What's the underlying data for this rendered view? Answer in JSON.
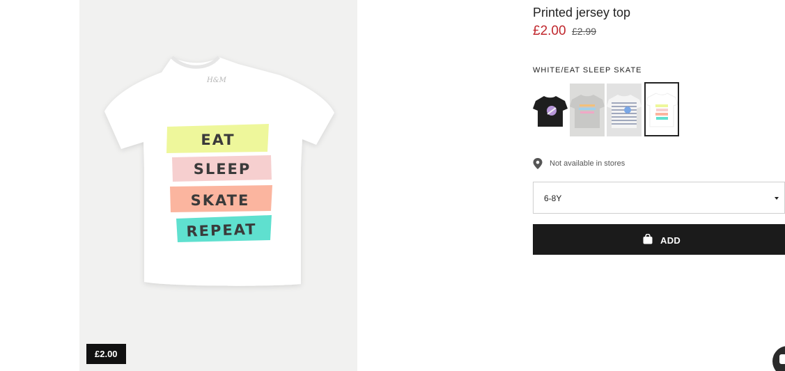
{
  "product": {
    "title": "Printed jersey top",
    "price_current": "£2.00",
    "price_original": "£2.99",
    "image_price_tag": "£2.00",
    "image_print_lines": [
      "EAT",
      "SLEEP",
      "SKATE",
      "REPEAT"
    ],
    "image_print_colors": [
      "#eef79b",
      "#f6cfcf",
      "#fbb59f",
      "#5fe0cf"
    ]
  },
  "colors": {
    "label": "WHITE/EAT SLEEP SKATE",
    "swatches": [
      {
        "name": "Black unicorn print",
        "icon": "black-tshirt-thumbnail",
        "selected": false
      },
      {
        "name": "Grey rainbow print",
        "icon": "grey-tshirt-thumbnail",
        "selected": false
      },
      {
        "name": "Striped print",
        "icon": "striped-tshirt-thumbnail",
        "selected": false
      },
      {
        "name": "White/Eat Sleep Skate",
        "icon": "white-tshirt-thumbnail",
        "selected": true
      }
    ]
  },
  "availability": {
    "icon": "map-pin-icon",
    "text": "Not available in stores"
  },
  "size_select": {
    "value": "6-8Y",
    "icon": "caret-down-icon"
  },
  "add_button": {
    "label": "ADD",
    "icon": "shopping-bag-icon"
  },
  "chat": {
    "icon": "chat-icon"
  },
  "theme": {
    "price_red": "#c0272d",
    "button_black": "#1b1b1b"
  }
}
